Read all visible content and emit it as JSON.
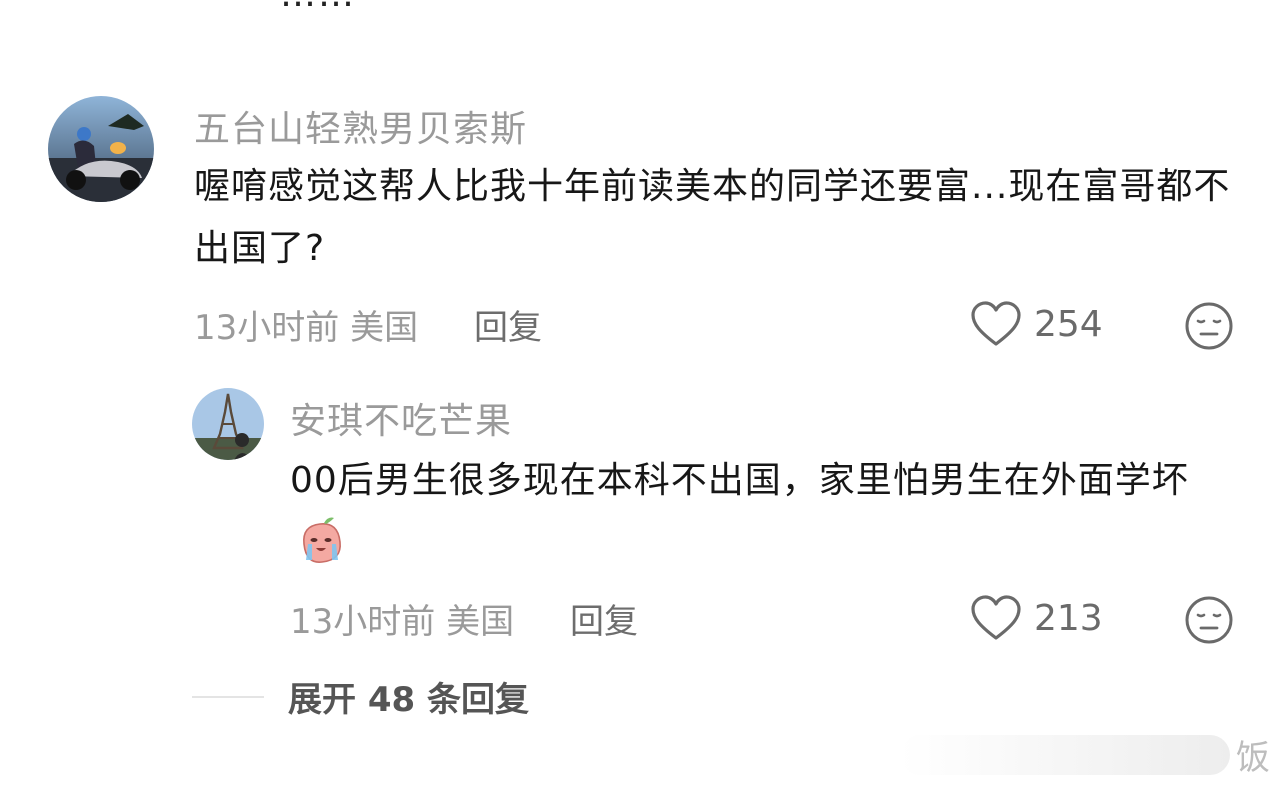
{
  "top_partial_text": "……",
  "comments": [
    {
      "username": "五台山轻熟男贝索斯",
      "text": "喔唷感觉这帮人比我十年前读美本的同学还要富...现在富哥都不出国了?",
      "time_location": "13小时前 美国",
      "reply_label": "回复",
      "likes": "254"
    },
    {
      "username": "安琪不吃芒果",
      "text": "00后男生很多现在本科不出国，家里怕男生在外面学坏",
      "time_location": "13小时前 美国",
      "reply_label": "回复",
      "likes": "213"
    }
  ],
  "expand_replies": "展开 48 条回复",
  "watermark": "饭",
  "colors": {
    "secondary_text": "#9a9a9a",
    "primary_text": "#171717"
  },
  "icons": [
    "heart-icon",
    "neutral-face-icon",
    "peach-crying-emoji"
  ]
}
